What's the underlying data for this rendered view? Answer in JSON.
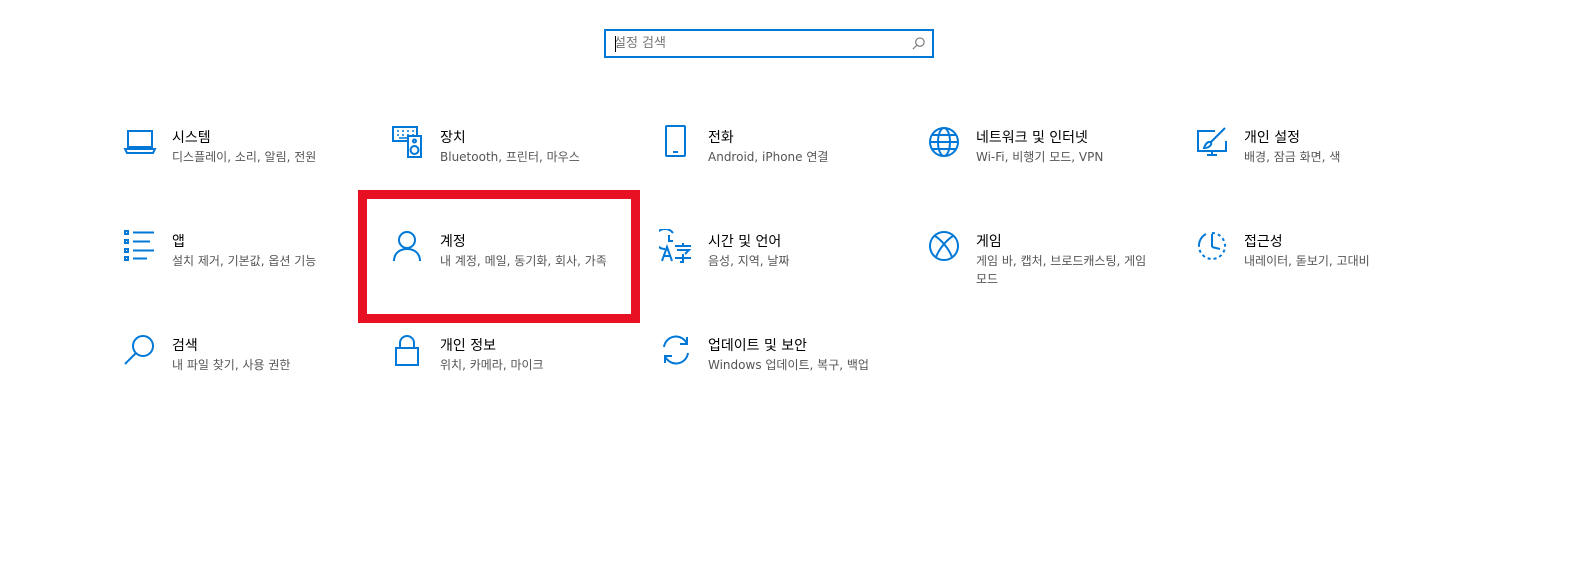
{
  "search": {
    "placeholder": "설정 검색",
    "value": ""
  },
  "accent_color": "#0078d7",
  "highlight_color": "#e81123",
  "tiles": [
    {
      "title": "시스템",
      "desc": "디스플레이, 소리, 알림, 전원",
      "icon": "laptop-icon"
    },
    {
      "title": "장치",
      "desc": "Bluetooth, 프린터, 마우스",
      "icon": "devices-icon"
    },
    {
      "title": "전화",
      "desc": "Android, iPhone 연결",
      "icon": "phone-icon"
    },
    {
      "title": "네트워크 및 인터넷",
      "desc": "Wi-Fi, 비행기 모드, VPN",
      "icon": "globe-icon"
    },
    {
      "title": "개인 설정",
      "desc": "배경, 잠금 화면, 색",
      "icon": "personalization-icon"
    },
    {
      "title": "앱",
      "desc": "설치 제거, 기본값, 옵션 기능",
      "icon": "apps-list-icon"
    },
    {
      "title": "계정",
      "desc": "내 계정, 메일, 동기화, 회사, 가족",
      "icon": "person-icon"
    },
    {
      "title": "시간 및 언어",
      "desc": "음성, 지역, 날짜",
      "icon": "time-language-icon"
    },
    {
      "title": "게임",
      "desc": "게임 바, 캡처, 브로드캐스팅, 게임 모드",
      "icon": "xbox-icon"
    },
    {
      "title": "접근성",
      "desc": "내레이터, 돋보기, 고대비",
      "icon": "accessibility-icon"
    },
    {
      "title": "검색",
      "desc": "내 파일 찾기, 사용 권한",
      "icon": "search-magnifier-icon"
    },
    {
      "title": "개인 정보",
      "desc": "위치, 카메라, 마이크",
      "icon": "lock-icon"
    },
    {
      "title": "업데이트 및 보안",
      "desc": "Windows 업데이트, 복구, 백업",
      "icon": "sync-icon"
    }
  ]
}
